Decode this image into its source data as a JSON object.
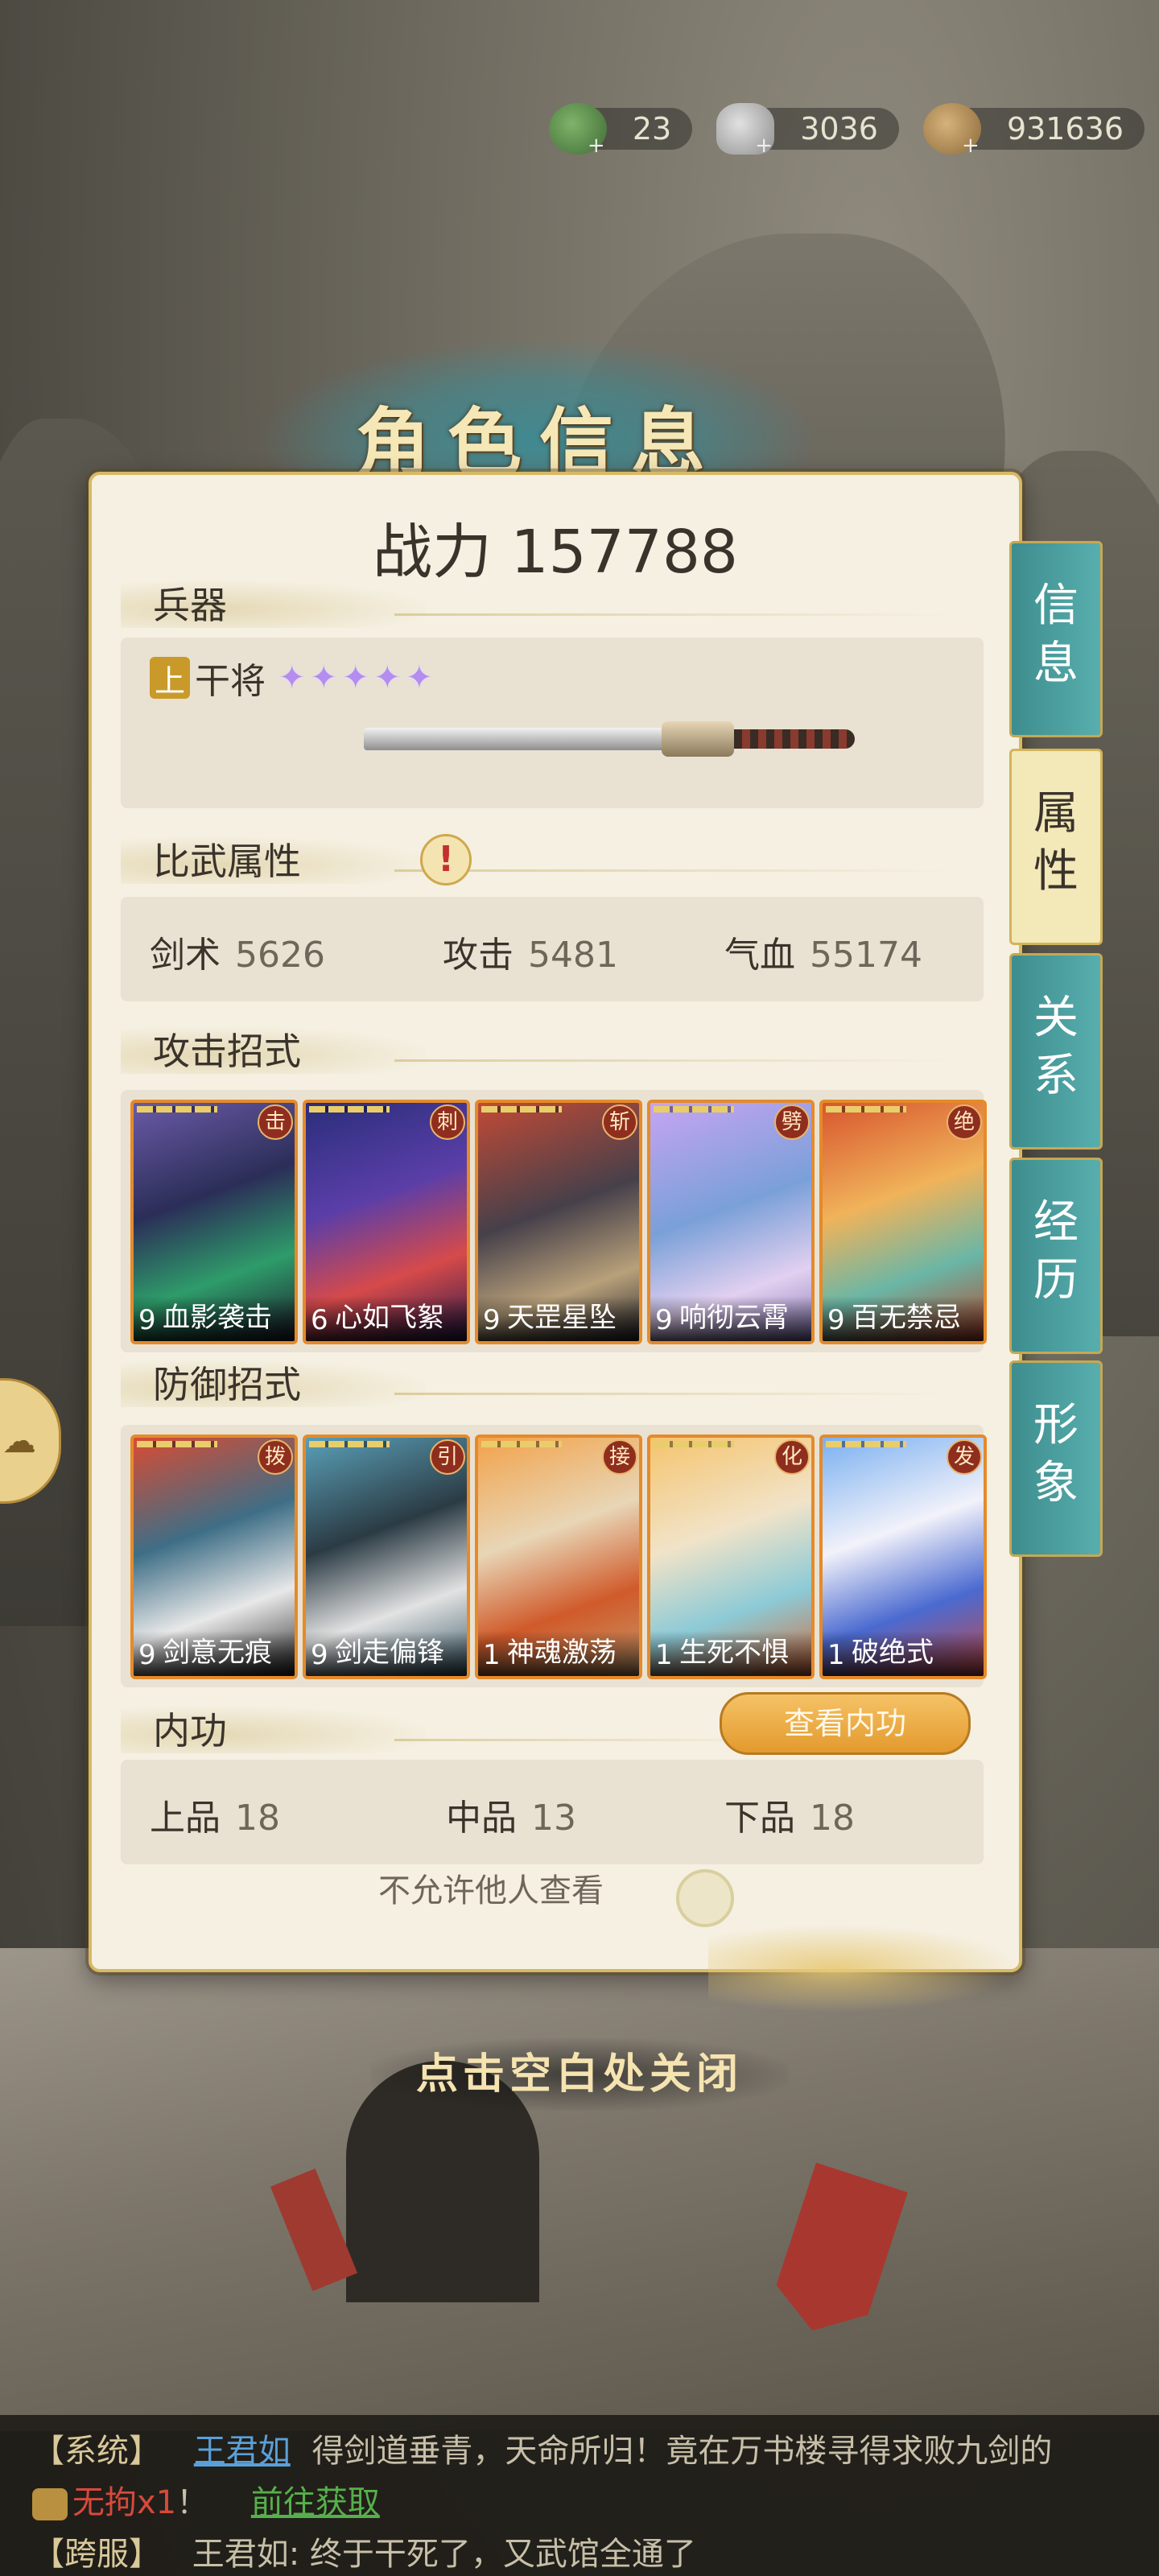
{
  "currency": [
    {
      "name": "jade-dragon-icon",
      "value": "23"
    },
    {
      "name": "silver-ingot-icon",
      "value": "3036"
    },
    {
      "name": "copper-coins-icon",
      "value": "931636"
    }
  ],
  "title": "角色信息",
  "power_label": "战力 157788",
  "weapon": {
    "section": "兵器",
    "grade": "上",
    "name": "干将",
    "stars": 5
  },
  "combat_attributes": {
    "section": "比武属性",
    "stats": [
      {
        "label": "剑术",
        "value": "5626"
      },
      {
        "label": "攻击",
        "value": "5481"
      },
      {
        "label": "气血",
        "value": "55174"
      }
    ]
  },
  "attack_moves": {
    "section": "攻击招式",
    "cards": [
      {
        "tag": "击",
        "level": "9",
        "name": "血影袭击"
      },
      {
        "tag": "刺",
        "level": "6",
        "name": "心如飞絮"
      },
      {
        "tag": "斩",
        "level": "9",
        "name": "天罡星坠"
      },
      {
        "tag": "劈",
        "level": "9",
        "name": "响彻云霄"
      },
      {
        "tag": "绝",
        "level": "9",
        "name": "百无禁忌"
      }
    ]
  },
  "defense_moves": {
    "section": "防御招式",
    "cards": [
      {
        "tag": "拨",
        "level": "9",
        "name": "剑意无痕"
      },
      {
        "tag": "引",
        "level": "9",
        "name": "剑走偏锋"
      },
      {
        "tag": "接",
        "level": "1",
        "name": "神魂激荡"
      },
      {
        "tag": "化",
        "level": "1",
        "name": "生死不惧"
      },
      {
        "tag": "发",
        "level": "1",
        "name": "破绝式"
      }
    ]
  },
  "inner_power": {
    "section": "内功",
    "button": "查看内功",
    "grades": [
      {
        "label": "上品",
        "value": "18"
      },
      {
        "label": "中品",
        "value": "13"
      },
      {
        "label": "下品",
        "value": "18"
      }
    ]
  },
  "privacy_label": "不允许他人查看",
  "tabs": [
    {
      "label": "信息",
      "active": false
    },
    {
      "label": "属性",
      "active": true
    },
    {
      "label": "关系",
      "active": false
    },
    {
      "label": "经历",
      "active": false
    },
    {
      "label": "形象",
      "active": false
    }
  ],
  "close_hint": "点击空白处关闭",
  "chat": {
    "line1": {
      "channel": "【系统】",
      "name": "王君如",
      "text": "得剑道垂青，天命所归！竟在万书楼寻得求败九剑的"
    },
    "line2": {
      "item": "无拘x1",
      "punct": "！",
      "link": "前往获取"
    },
    "line3": {
      "channel": "【跨服】",
      "text": "王君如: 终于干死了，又武馆全通了"
    }
  }
}
